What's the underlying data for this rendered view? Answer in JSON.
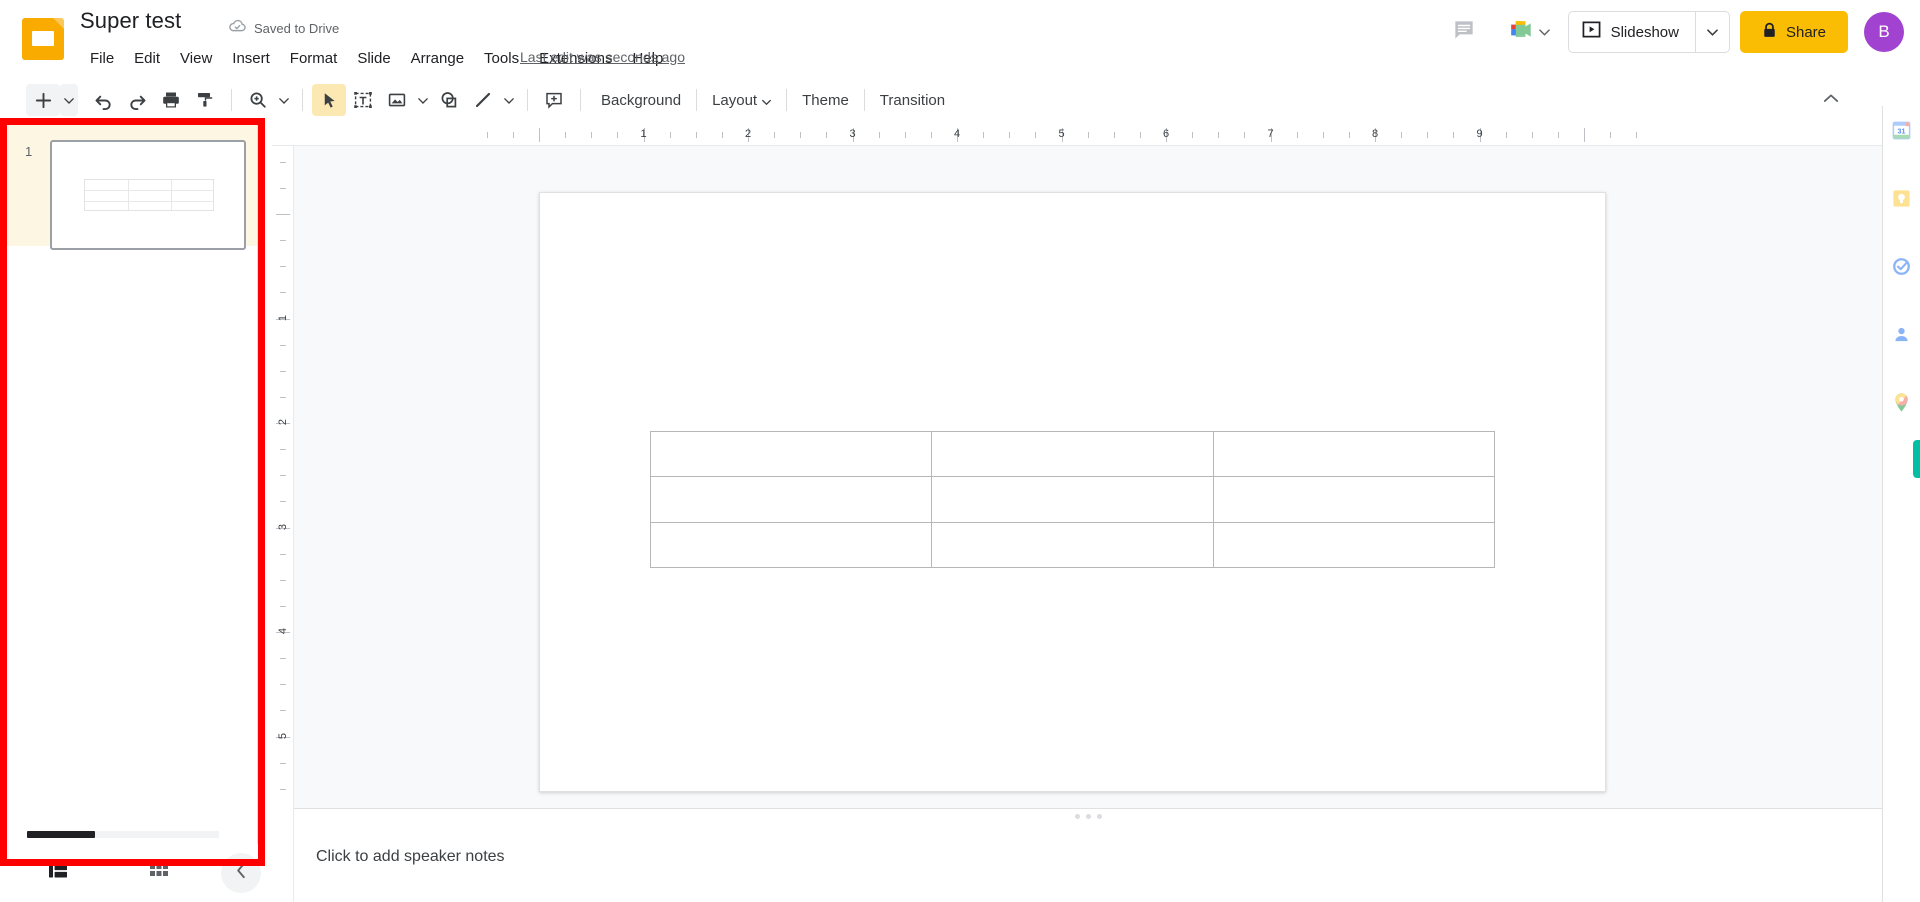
{
  "app": {
    "logo_icon": "google-slides-logo-icon",
    "title": "Super test",
    "save_status": "Saved to Drive",
    "save_status_icon": "cloud-check-icon"
  },
  "menubar": {
    "items": [
      {
        "label": "File"
      },
      {
        "label": "Edit"
      },
      {
        "label": "View"
      },
      {
        "label": "Insert"
      },
      {
        "label": "Format"
      },
      {
        "label": "Slide"
      },
      {
        "label": "Arrange"
      },
      {
        "label": "Tools"
      },
      {
        "label": "Extensions"
      },
      {
        "label": "Help"
      }
    ],
    "last_edit": "Last edit was seconds ago"
  },
  "header_actions": {
    "comment_icon": "comment-history-icon",
    "meet_icon": "google-meet-icon",
    "meet_caret_icon": "chevron-down-icon",
    "slideshow_icon": "present-play-icon",
    "slideshow_label": "Slideshow",
    "slideshow_caret_icon": "chevron-down-icon",
    "share_icon": "lock-icon",
    "share_label": "Share",
    "avatar_initial": "B",
    "avatar_color": "#A142D0",
    "share_color": "#FBBC04"
  },
  "toolbar": {
    "icons": [
      {
        "name": "new-slide-icon",
        "glyph": "plus"
      },
      {
        "name": "new-slide-caret-icon",
        "glyph": "caret"
      },
      {
        "name": "undo-icon",
        "glyph": "undo"
      },
      {
        "name": "redo-icon",
        "glyph": "redo"
      },
      {
        "name": "print-icon",
        "glyph": "print"
      },
      {
        "name": "paint-format-icon",
        "glyph": "paint"
      },
      {
        "name": "zoom-icon",
        "glyph": "zoom"
      },
      {
        "name": "zoom-caret-icon",
        "glyph": "caret"
      },
      {
        "name": "select-tool-icon",
        "glyph": "cursor"
      },
      {
        "name": "text-box-icon",
        "glyph": "textbox"
      },
      {
        "name": "insert-image-icon",
        "glyph": "image"
      },
      {
        "name": "insert-image-caret-icon",
        "glyph": "caret"
      },
      {
        "name": "shape-icon",
        "glyph": "shape"
      },
      {
        "name": "line-icon",
        "glyph": "line"
      },
      {
        "name": "line-caret-icon",
        "glyph": "caret"
      },
      {
        "name": "add-comment-icon",
        "glyph": "comment"
      }
    ],
    "active_tool": "select-tool-icon",
    "buttons": [
      {
        "label": "Background",
        "has_caret": false
      },
      {
        "label": "Layout",
        "has_caret": true
      },
      {
        "label": "Theme",
        "has_caret": false
      },
      {
        "label": "Transition",
        "has_caret": false
      }
    ],
    "collapse_icon": "chevron-up-icon"
  },
  "filmstrip": {
    "slides": [
      {
        "number": "1",
        "selected": true,
        "content": "table-3x3"
      }
    ],
    "scrollbar": "horizontal-scrollbar"
  },
  "bottom_bar": {
    "filmstrip_view_icon": "filmstrip-view-icon",
    "grid_view_icon": "grid-view-icon",
    "collapse_icon": "chevron-left-icon"
  },
  "ruler": {
    "horizontal_marks": [
      "1",
      "2",
      "3",
      "4",
      "5",
      "6",
      "7",
      "8",
      "9"
    ],
    "vertical_marks": [
      "1",
      "2",
      "3",
      "4",
      "5"
    ]
  },
  "slide": {
    "table": {
      "rows": 3,
      "cols": 3,
      "border_color": "#b7b7b7",
      "cells": [
        [
          "",
          "",
          ""
        ],
        [
          "",
          "",
          ""
        ],
        [
          "",
          "",
          ""
        ]
      ]
    }
  },
  "notes": {
    "placeholder": "Click to add speaker notes",
    "drag_handle_icon": "drag-dots-icon"
  },
  "side_panel": {
    "items": [
      {
        "name": "google-calendar-icon",
        "label": "Calendar"
      },
      {
        "name": "google-keep-icon",
        "label": "Keep"
      },
      {
        "name": "google-tasks-icon",
        "label": "Tasks"
      },
      {
        "name": "google-contacts-icon",
        "label": "Contacts"
      },
      {
        "name": "google-maps-icon",
        "label": "Maps"
      }
    ],
    "expand_tab_color": "#00BFA5"
  },
  "annotation": {
    "highlight_color": "#FF0000",
    "target": "filmstrip-panel"
  }
}
